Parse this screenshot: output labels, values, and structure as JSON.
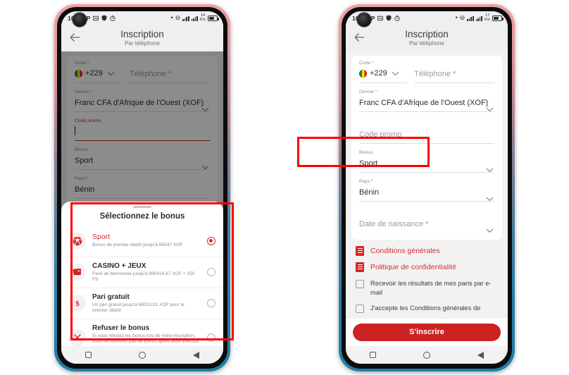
{
  "screens": [
    {
      "id": "left",
      "status": {
        "time": "10:40",
        "left_icons": [
          "P",
          "screenshot-icon",
          "shield-icon",
          "timer-icon"
        ],
        "dot": "•",
        "dnd": "⊖",
        "net_speed": "14",
        "net_unit": "K/s",
        "signal": "signal-bars-icon",
        "battery": "battery-icon"
      },
      "header": {
        "title": "Inscription",
        "subtitle": "Par téléphone",
        "back": "back-arrow-icon"
      },
      "form": {
        "code_label": "Code *",
        "code_value": "+229",
        "phone_placeholder": "Téléphone *",
        "devise_label": "Devise *",
        "devise_value": "Franc CFA d'Afrique de l'Ouest (XOF)",
        "promo_label": "Code promo",
        "promo_value": "",
        "bonus_label": "Bonus",
        "bonus_value": "Sport",
        "pays_label": "Pays *",
        "pays_value": "Bénin"
      },
      "sheet": {
        "title": "Sélectionnez le bonus",
        "options": [
          {
            "icon": "soccer-ball-icon",
            "title": "Sport",
            "desc": "Bonus de premier dépôt jusqu'à 65547 XOF",
            "selected": true
          },
          {
            "icon": "playing-cards-icon",
            "title": "CASINO + JEUX",
            "desc": "Pack de bienvenue jusqu'à 985416.67 XOF + 150 FS",
            "selected": false
          },
          {
            "icon": "dollar-icon",
            "title": "Pari gratuit",
            "desc": "Un pari gratuit jusqu'à 66513.91 XOF pour le premier dépôt",
            "selected": false
          },
          {
            "icon": "cross-icon",
            "title": "Refuser le bonus",
            "desc": "Si vous refusez les bonus lors de votre inscription, vous ne recevrez pas de bonus après avoir effectué votre pr..",
            "selected": false
          }
        ]
      },
      "nav": [
        "square-icon",
        "circle-icon",
        "back-triangle-icon"
      ]
    },
    {
      "id": "right",
      "status": {
        "time": "10:55",
        "left_icons": [
          "P",
          "screenshot-icon",
          "shield-icon",
          "timer-icon"
        ],
        "dot": "•",
        "dnd": "⊖",
        "net_speed": "17",
        "net_unit": "K/s",
        "signal": "signal-bars-icon",
        "battery": "battery-icon"
      },
      "header": {
        "title": "Inscription",
        "subtitle": "Par téléphone",
        "back": "back-arrow-icon"
      },
      "form": {
        "code_label": "Code *",
        "code_value": "+229",
        "phone_placeholder": "Téléphone *",
        "devise_label": "Devise *",
        "devise_value": "Franc CFA d'Afrique de l'Ouest (XOF)",
        "promo_label": "",
        "promo_placeholder": "Code promo",
        "bonus_label": "Bonus",
        "bonus_value": "Sport",
        "pays_label": "Pays *",
        "pays_value": "Bénin",
        "birth_placeholder": "Date de naissance *"
      },
      "links": [
        {
          "icon": "document-icon",
          "label": "Conditions générales"
        },
        {
          "icon": "document-icon",
          "label": "Politique de confidentialité"
        }
      ],
      "checkboxes": [
        {
          "label": "Recevoir les résultats de mes paris par e-mail",
          "checked": false
        },
        {
          "label": "J'accepte les Conditions générales de",
          "checked": false
        }
      ],
      "submit_label": "S'inscrire",
      "nav": [
        "square-icon",
        "circle-icon",
        "back-triangle-icon"
      ]
    }
  ],
  "colors": {
    "accent": "#d32f2f",
    "cta": "#cc2222",
    "highlight": "#ff0000",
    "frame_top": "#f0a0a4",
    "frame_bottom": "#1d7fa8"
  }
}
